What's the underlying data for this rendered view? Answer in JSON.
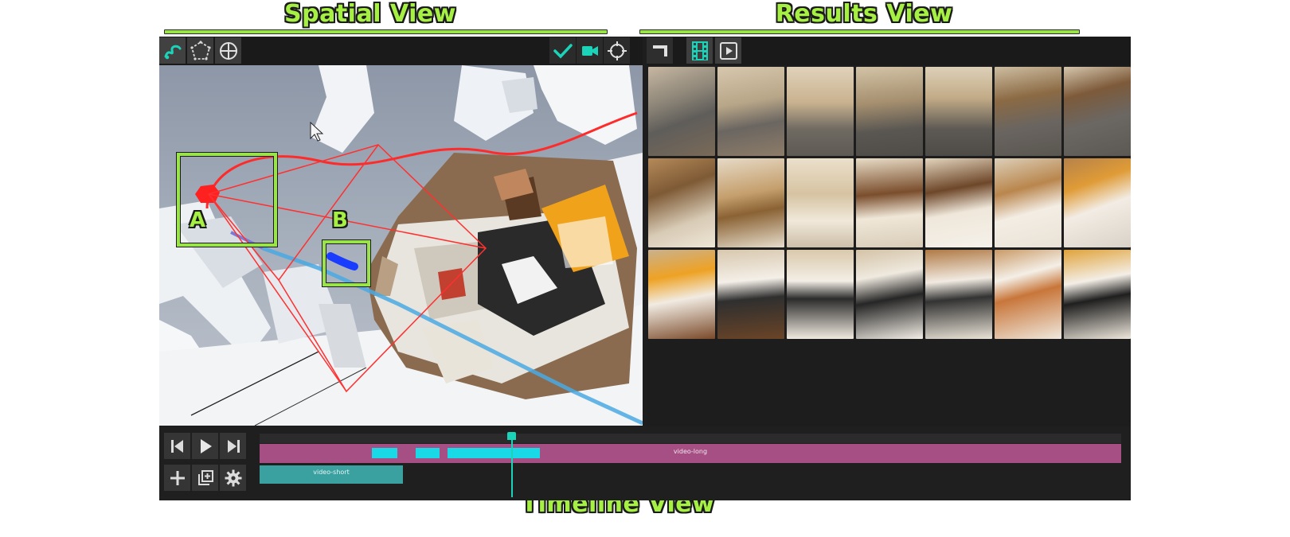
{
  "labels": {
    "spatial_view": "Spatial View",
    "results_view": "Results View",
    "timeline_view": "Timeline View"
  },
  "spatial": {
    "tools": [
      "path-draw-icon",
      "polygon-select-icon",
      "crosshair-icon"
    ],
    "right_tools": [
      "checkmark-icon",
      "video-camera-icon",
      "target-icon"
    ],
    "annotations": {
      "a": "A",
      "b": "B"
    }
  },
  "results": {
    "tools": [
      "cut-icon",
      "filmstrip-icon",
      "play-box-icon"
    ],
    "thumbnails_count": 21
  },
  "timeline": {
    "controls": [
      "step-back-icon",
      "play-icon",
      "step-forward-icon",
      "add-icon",
      "add-stack-icon",
      "gear-icon"
    ],
    "track_long": "video-long",
    "track_short": "video-short"
  },
  "colors": {
    "accent_green": "#a6f043",
    "teal": "#1bd3b9",
    "track_long": "#a64f84",
    "track_short": "#3aa1a0",
    "segment": "#19d9e7",
    "camera_red": "#ff2020",
    "path_blue": "#1a3cff"
  }
}
